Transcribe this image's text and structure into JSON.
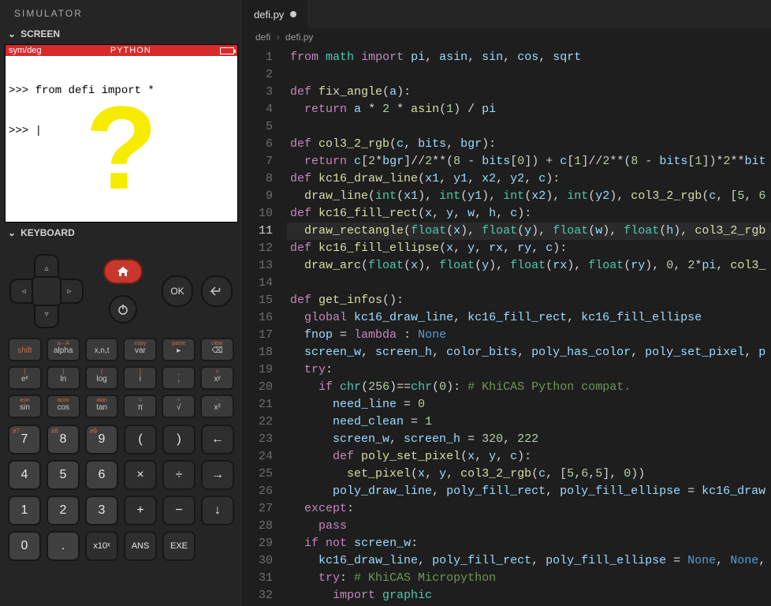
{
  "sim": {
    "title": "SIMULATOR",
    "screen_label": "SCREEN",
    "keyboard_label": "KEYBOARD",
    "status": {
      "left": "sym/deg",
      "center": "PYTHON"
    },
    "console_lines": [
      ">>> from defi import *",
      ">>> "
    ]
  },
  "keys": {
    "ok": "OK",
    "func_rows": [
      [
        "shift",
        "alpha",
        "x,n,t",
        "var",
        "▸",
        "⌫"
      ],
      [
        "eˣ",
        "ln",
        "log",
        "i",
        "  ,",
        "xʸ"
      ],
      [
        "sin",
        "cos",
        "tan",
        "π",
        "√",
        "x²"
      ]
    ],
    "func_sup": [
      [
        "",
        "a↔A",
        "",
        "copy",
        "paste",
        "clear"
      ],
      [
        "[",
        "]",
        "{",
        "}",
        "_",
        ">"
      ],
      [
        "asin",
        "acos",
        "atan",
        "=",
        "<",
        "-"
      ]
    ],
    "num_rows": [
      [
        "7",
        "8",
        "9",
        "(",
        ")",
        "←"
      ],
      [
        "4",
        "5",
        "6",
        "×",
        "÷",
        "→"
      ],
      [
        "1",
        "2",
        "3",
        "+",
        "−",
        "↓"
      ],
      [
        "0",
        ".",
        "x10ˣ",
        "ANS",
        "EXE",
        ""
      ]
    ],
    "num_sup": [
      [
        "#7",
        "#8",
        "#9",
        "",
        "",
        ""
      ],
      [
        "",
        "",
        "",
        "",
        "",
        ""
      ],
      [
        "",
        "",
        "",
        "",
        "",
        ""
      ],
      [
        "",
        "",
        "",
        "",
        "",
        ""
      ]
    ]
  },
  "editor": {
    "tab_name": "defi.py",
    "crumb_root": "defi",
    "crumb_file": "defi.py",
    "active_line": 11,
    "code": [
      [
        [
          "kw",
          "from"
        ],
        [
          "p",
          " "
        ],
        [
          "mod",
          "math"
        ],
        [
          "p",
          " "
        ],
        [
          "kw",
          "import"
        ],
        [
          "p",
          " "
        ],
        [
          "var",
          "pi"
        ],
        [
          "p",
          ", "
        ],
        [
          "var",
          "asin"
        ],
        [
          "p",
          ", "
        ],
        [
          "var",
          "sin"
        ],
        [
          "p",
          ", "
        ],
        [
          "var",
          "cos"
        ],
        [
          "p",
          ", "
        ],
        [
          "var",
          "sqrt"
        ]
      ],
      [],
      [
        [
          "kw",
          "def"
        ],
        [
          "p",
          " "
        ],
        [
          "fn",
          "fix_angle"
        ],
        [
          "p",
          "("
        ],
        [
          "var",
          "a"
        ],
        [
          "p",
          "):"
        ]
      ],
      [
        [
          "p",
          "  "
        ],
        [
          "kw",
          "return"
        ],
        [
          "p",
          " "
        ],
        [
          "var",
          "a"
        ],
        [
          "p",
          " * "
        ],
        [
          "num",
          "2"
        ],
        [
          "p",
          " * "
        ],
        [
          "fn",
          "asin"
        ],
        [
          "p",
          "("
        ],
        [
          "num",
          "1"
        ],
        [
          "p",
          ") / "
        ],
        [
          "var",
          "pi"
        ]
      ],
      [],
      [
        [
          "kw",
          "def"
        ],
        [
          "p",
          " "
        ],
        [
          "fn",
          "col3_2_rgb"
        ],
        [
          "p",
          "("
        ],
        [
          "var",
          "c"
        ],
        [
          "p",
          ", "
        ],
        [
          "var",
          "bits"
        ],
        [
          "p",
          ", "
        ],
        [
          "var",
          "bgr"
        ],
        [
          "p",
          "):"
        ]
      ],
      [
        [
          "p",
          "  "
        ],
        [
          "kw",
          "return"
        ],
        [
          "p",
          " "
        ],
        [
          "var",
          "c"
        ],
        [
          "p",
          "["
        ],
        [
          "num",
          "2"
        ],
        [
          "p",
          "*"
        ],
        [
          "var",
          "bgr"
        ],
        [
          "p",
          "]//"
        ],
        [
          "num",
          "2"
        ],
        [
          "p",
          "**("
        ],
        [
          "num",
          "8"
        ],
        [
          "p",
          " - "
        ],
        [
          "var",
          "bits"
        ],
        [
          "p",
          "["
        ],
        [
          "num",
          "0"
        ],
        [
          "p",
          "]) + "
        ],
        [
          "var",
          "c"
        ],
        [
          "p",
          "["
        ],
        [
          "num",
          "1"
        ],
        [
          "p",
          "]//"
        ],
        [
          "num",
          "2"
        ],
        [
          "p",
          "**("
        ],
        [
          "num",
          "8"
        ],
        [
          "p",
          " - "
        ],
        [
          "var",
          "bits"
        ],
        [
          "p",
          "["
        ],
        [
          "num",
          "1"
        ],
        [
          "p",
          "])*"
        ],
        [
          "num",
          "2"
        ],
        [
          "p",
          "**"
        ],
        [
          "var",
          "bit"
        ]
      ],
      [
        [
          "kw",
          "def"
        ],
        [
          "p",
          " "
        ],
        [
          "fn",
          "kc16_draw_line"
        ],
        [
          "p",
          "("
        ],
        [
          "var",
          "x1"
        ],
        [
          "p",
          ", "
        ],
        [
          "var",
          "y1"
        ],
        [
          "p",
          ", "
        ],
        [
          "var",
          "x2"
        ],
        [
          "p",
          ", "
        ],
        [
          "var",
          "y2"
        ],
        [
          "p",
          ", "
        ],
        [
          "var",
          "c"
        ],
        [
          "p",
          "):"
        ]
      ],
      [
        [
          "p",
          "  "
        ],
        [
          "fn",
          "draw_line"
        ],
        [
          "p",
          "("
        ],
        [
          "bltn",
          "int"
        ],
        [
          "p",
          "("
        ],
        [
          "var",
          "x1"
        ],
        [
          "p",
          "), "
        ],
        [
          "bltn",
          "int"
        ],
        [
          "p",
          "("
        ],
        [
          "var",
          "y1"
        ],
        [
          "p",
          "), "
        ],
        [
          "bltn",
          "int"
        ],
        [
          "p",
          "("
        ],
        [
          "var",
          "x2"
        ],
        [
          "p",
          "), "
        ],
        [
          "bltn",
          "int"
        ],
        [
          "p",
          "("
        ],
        [
          "var",
          "y2"
        ],
        [
          "p",
          "), "
        ],
        [
          "fn",
          "col3_2_rgb"
        ],
        [
          "p",
          "("
        ],
        [
          "var",
          "c"
        ],
        [
          "p",
          ", ["
        ],
        [
          "num",
          "5"
        ],
        [
          "p",
          ", "
        ],
        [
          "num",
          "6"
        ]
      ],
      [
        [
          "kw",
          "def"
        ],
        [
          "p",
          " "
        ],
        [
          "fn",
          "kc16_fill_rect"
        ],
        [
          "p",
          "("
        ],
        [
          "var",
          "x"
        ],
        [
          "p",
          ", "
        ],
        [
          "var",
          "y"
        ],
        [
          "p",
          ", "
        ],
        [
          "var",
          "w"
        ],
        [
          "p",
          ", "
        ],
        [
          "var",
          "h"
        ],
        [
          "p",
          ", "
        ],
        [
          "var",
          "c"
        ],
        [
          "p",
          "):"
        ]
      ],
      [
        [
          "p",
          "  "
        ],
        [
          "fn",
          "draw_rectangle"
        ],
        [
          "p",
          "("
        ],
        [
          "bltn",
          "float"
        ],
        [
          "p",
          "("
        ],
        [
          "var",
          "x"
        ],
        [
          "p",
          "), "
        ],
        [
          "bltn",
          "float"
        ],
        [
          "p",
          "("
        ],
        [
          "var",
          "y"
        ],
        [
          "p",
          "), "
        ],
        [
          "bltn",
          "float"
        ],
        [
          "p",
          "("
        ],
        [
          "var",
          "w"
        ],
        [
          "p",
          "), "
        ],
        [
          "bltn",
          "float"
        ],
        [
          "p",
          "("
        ],
        [
          "var",
          "h"
        ],
        [
          "p",
          "), "
        ],
        [
          "fn",
          "col3_2_rgb"
        ]
      ],
      [
        [
          "kw",
          "def"
        ],
        [
          "p",
          " "
        ],
        [
          "fn",
          "kc16_fill_ellipse"
        ],
        [
          "p",
          "("
        ],
        [
          "var",
          "x"
        ],
        [
          "p",
          ", "
        ],
        [
          "var",
          "y"
        ],
        [
          "p",
          ", "
        ],
        [
          "var",
          "rx"
        ],
        [
          "p",
          ", "
        ],
        [
          "var",
          "ry"
        ],
        [
          "p",
          ", "
        ],
        [
          "var",
          "c"
        ],
        [
          "p",
          "):"
        ]
      ],
      [
        [
          "p",
          "  "
        ],
        [
          "fn",
          "draw_arc"
        ],
        [
          "p",
          "("
        ],
        [
          "bltn",
          "float"
        ],
        [
          "p",
          "("
        ],
        [
          "var",
          "x"
        ],
        [
          "p",
          "), "
        ],
        [
          "bltn",
          "float"
        ],
        [
          "p",
          "("
        ],
        [
          "var",
          "y"
        ],
        [
          "p",
          "), "
        ],
        [
          "bltn",
          "float"
        ],
        [
          "p",
          "("
        ],
        [
          "var",
          "rx"
        ],
        [
          "p",
          "), "
        ],
        [
          "bltn",
          "float"
        ],
        [
          "p",
          "("
        ],
        [
          "var",
          "ry"
        ],
        [
          "p",
          "), "
        ],
        [
          "num",
          "0"
        ],
        [
          "p",
          ", "
        ],
        [
          "num",
          "2"
        ],
        [
          "p",
          "*"
        ],
        [
          "var",
          "pi"
        ],
        [
          "p",
          ", "
        ],
        [
          "fn",
          "col3_"
        ]
      ],
      [],
      [
        [
          "kw",
          "def"
        ],
        [
          "p",
          " "
        ],
        [
          "fn",
          "get_infos"
        ],
        [
          "p",
          "():"
        ]
      ],
      [
        [
          "p",
          "  "
        ],
        [
          "kw",
          "global"
        ],
        [
          "p",
          " "
        ],
        [
          "var",
          "kc16_draw_line"
        ],
        [
          "p",
          ", "
        ],
        [
          "var",
          "kc16_fill_rect"
        ],
        [
          "p",
          ", "
        ],
        [
          "var",
          "kc16_fill_ellipse"
        ]
      ],
      [
        [
          "p",
          "  "
        ],
        [
          "var",
          "fnop"
        ],
        [
          "p",
          " = "
        ],
        [
          "kw",
          "lambda"
        ],
        [
          "p",
          " : "
        ],
        [
          "const",
          "None"
        ]
      ],
      [
        [
          "p",
          "  "
        ],
        [
          "var",
          "screen_w"
        ],
        [
          "p",
          ", "
        ],
        [
          "var",
          "screen_h"
        ],
        [
          "p",
          ", "
        ],
        [
          "var",
          "color_bits"
        ],
        [
          "p",
          ", "
        ],
        [
          "var",
          "poly_has_color"
        ],
        [
          "p",
          ", "
        ],
        [
          "var",
          "poly_set_pixel"
        ],
        [
          "p",
          ", "
        ],
        [
          "var",
          "p"
        ]
      ],
      [
        [
          "p",
          "  "
        ],
        [
          "kw",
          "try"
        ],
        [
          "p",
          ":"
        ]
      ],
      [
        [
          "p",
          "    "
        ],
        [
          "kw",
          "if"
        ],
        [
          "p",
          " "
        ],
        [
          "bltn",
          "chr"
        ],
        [
          "p",
          "("
        ],
        [
          "num",
          "256"
        ],
        [
          "p",
          ")=="
        ],
        [
          "bltn",
          "chr"
        ],
        [
          "p",
          "("
        ],
        [
          "num",
          "0"
        ],
        [
          "p",
          "): "
        ],
        [
          "cmt",
          "# KhiCAS Python compat."
        ]
      ],
      [
        [
          "p",
          "      "
        ],
        [
          "var",
          "need_line"
        ],
        [
          "p",
          " = "
        ],
        [
          "num",
          "0"
        ]
      ],
      [
        [
          "p",
          "      "
        ],
        [
          "var",
          "need_clean"
        ],
        [
          "p",
          " = "
        ],
        [
          "num",
          "1"
        ]
      ],
      [
        [
          "p",
          "      "
        ],
        [
          "var",
          "screen_w"
        ],
        [
          "p",
          ", "
        ],
        [
          "var",
          "screen_h"
        ],
        [
          "p",
          " = "
        ],
        [
          "num",
          "320"
        ],
        [
          "p",
          ", "
        ],
        [
          "num",
          "222"
        ]
      ],
      [
        [
          "p",
          "      "
        ],
        [
          "kw",
          "def"
        ],
        [
          "p",
          " "
        ],
        [
          "fn",
          "poly_set_pixel"
        ],
        [
          "p",
          "("
        ],
        [
          "var",
          "x"
        ],
        [
          "p",
          ", "
        ],
        [
          "var",
          "y"
        ],
        [
          "p",
          ", "
        ],
        [
          "var",
          "c"
        ],
        [
          "p",
          "):"
        ]
      ],
      [
        [
          "p",
          "        "
        ],
        [
          "fn",
          "set_pixel"
        ],
        [
          "p",
          "("
        ],
        [
          "var",
          "x"
        ],
        [
          "p",
          ", "
        ],
        [
          "var",
          "y"
        ],
        [
          "p",
          ", "
        ],
        [
          "fn",
          "col3_2_rgb"
        ],
        [
          "p",
          "("
        ],
        [
          "var",
          "c"
        ],
        [
          "p",
          ", ["
        ],
        [
          "num",
          "5"
        ],
        [
          "p",
          ","
        ],
        [
          "num",
          "6"
        ],
        [
          "p",
          ","
        ],
        [
          "num",
          "5"
        ],
        [
          "p",
          "], "
        ],
        [
          "num",
          "0"
        ],
        [
          "p",
          "))"
        ]
      ],
      [
        [
          "p",
          "      "
        ],
        [
          "var",
          "poly_draw_line"
        ],
        [
          "p",
          ", "
        ],
        [
          "var",
          "poly_fill_rect"
        ],
        [
          "p",
          ", "
        ],
        [
          "var",
          "poly_fill_ellipse"
        ],
        [
          "p",
          " = "
        ],
        [
          "var",
          "kc16_draw"
        ]
      ],
      [
        [
          "p",
          "  "
        ],
        [
          "kw",
          "except"
        ],
        [
          "p",
          ":"
        ]
      ],
      [
        [
          "p",
          "    "
        ],
        [
          "kw",
          "pass"
        ]
      ],
      [
        [
          "p",
          "  "
        ],
        [
          "kw",
          "if"
        ],
        [
          "p",
          " "
        ],
        [
          "kw",
          "not"
        ],
        [
          "p",
          " "
        ],
        [
          "var",
          "screen_w"
        ],
        [
          "p",
          ":"
        ]
      ],
      [
        [
          "p",
          "    "
        ],
        [
          "var",
          "kc16_draw_line"
        ],
        [
          "p",
          ", "
        ],
        [
          "var",
          "poly_fill_rect"
        ],
        [
          "p",
          ", "
        ],
        [
          "var",
          "poly_fill_ellipse"
        ],
        [
          "p",
          " = "
        ],
        [
          "const",
          "None"
        ],
        [
          "p",
          ", "
        ],
        [
          "const",
          "None"
        ],
        [
          "p",
          ","
        ]
      ],
      [
        [
          "p",
          "    "
        ],
        [
          "kw",
          "try"
        ],
        [
          "p",
          ": "
        ],
        [
          "cmt",
          "# KhiCAS Micropython"
        ]
      ],
      [
        [
          "p",
          "      "
        ],
        [
          "kw",
          "import"
        ],
        [
          "p",
          " "
        ],
        [
          "mod",
          "graphic"
        ]
      ]
    ]
  }
}
